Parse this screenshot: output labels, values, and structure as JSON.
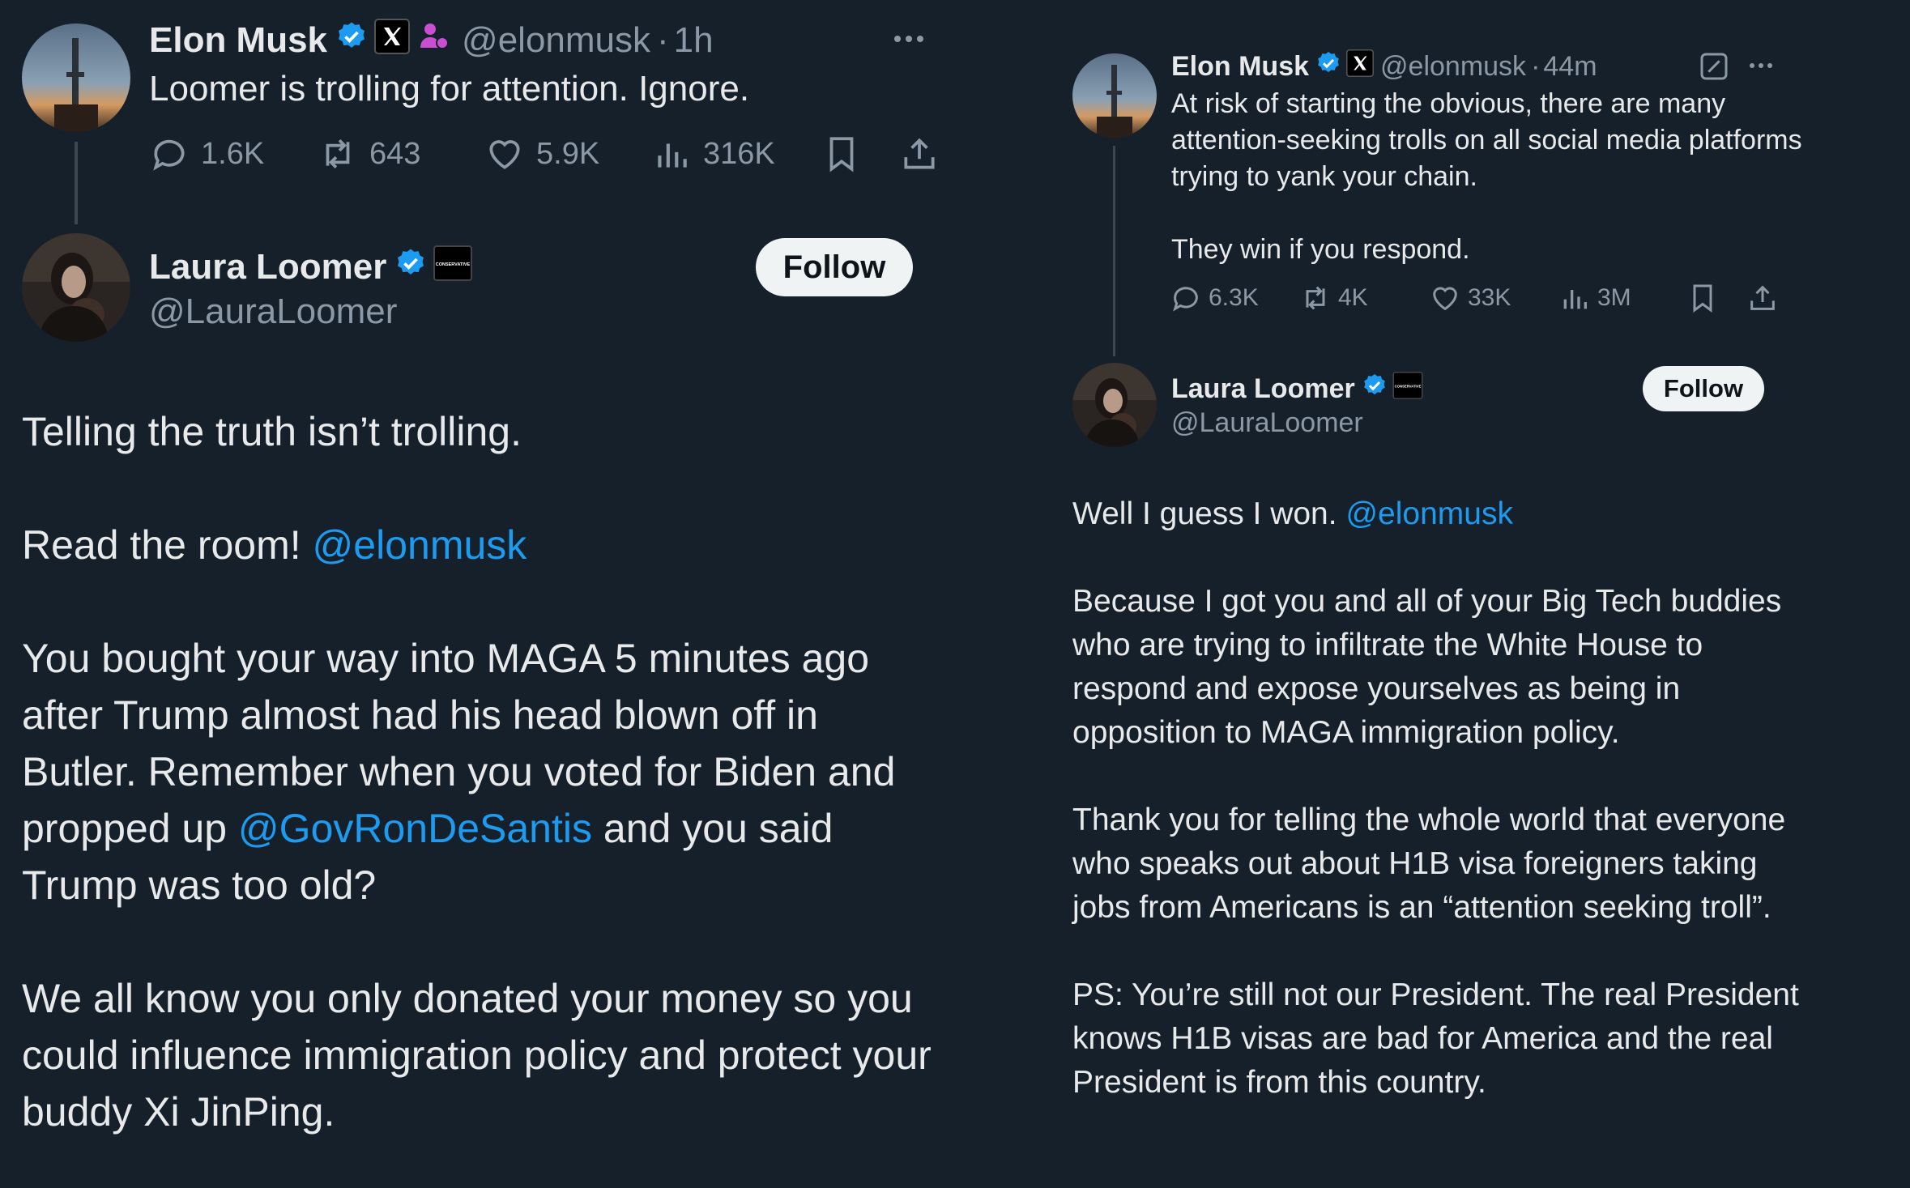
{
  "left": {
    "musk_tweet": {
      "name": "Elon Musk",
      "handle": "@elonmusk",
      "sep": "·",
      "time": "1h",
      "text": "Loomer is trolling for attention. Ignore.",
      "replies": "1.6K",
      "reposts": "643",
      "likes": "5.9K",
      "views": "316K"
    },
    "loomer_tweet": {
      "name": "Laura Loomer",
      "handle": "@LauraLoomer",
      "follow": "Follow",
      "badge_text": "CONSERVATIVE",
      "p1": "Telling the truth isn’t trolling.",
      "p2_text": "Read the room!",
      "p2_mention": "@elonmusk",
      "p3_a": "You bought your way into MAGA 5 minutes ago after Trump almost had his head blown off in Butler. Remember when you voted for Biden and propped up",
      "p3_mention": "@GovRonDeSantis",
      "p3_b": "and you said Trump was too old?",
      "p4": "We all know you only donated your money so you could influence immigration policy and protect your buddy Xi JinPing."
    }
  },
  "right": {
    "musk_tweet": {
      "name": "Elon Musk",
      "handle": "@elonmusk",
      "sep": "·",
      "time": "44m",
      "text_p1": "At risk of starting the obvious, there are many attention-seeking trolls on all social media platforms trying to yank your chain.",
      "text_p2": "They win if you respond.",
      "replies": "6.3K",
      "reposts": "4K",
      "likes": "33K",
      "views": "3M"
    },
    "loomer_tweet": {
      "name": "Laura Loomer",
      "handle": "@LauraLoomer",
      "follow": "Follow",
      "badge_text": "CONSERVATIVE",
      "p1_text": "Well I guess I won.",
      "p1_mention": "@elonmusk",
      "p2": "Because I got you and all of your Big Tech buddies who are trying to infiltrate the White House to respond and expose yourselves as being in opposition to MAGA immigration policy.",
      "p3": "Thank you for telling the whole world that everyone who speaks out about H1B visa foreigners taking jobs from Americans is an “attention seeking troll”.",
      "p4": "PS: You’re still not our President. The real President knows H1B visas are bad for America and the real President is from this country."
    }
  },
  "colors": {
    "background": "#16202a",
    "text": "#e7e9ea",
    "secondary": "#8b98a5",
    "accent": "#1d9bf0",
    "affiliate": "#c94fd0"
  },
  "icons": [
    "verified-badge-icon",
    "x-affiliation-icon",
    "person-affiliate-icon",
    "reply-icon",
    "repost-icon",
    "like-icon",
    "views-icon",
    "bookmark-icon",
    "share-icon",
    "more-icon",
    "grok-icon"
  ]
}
